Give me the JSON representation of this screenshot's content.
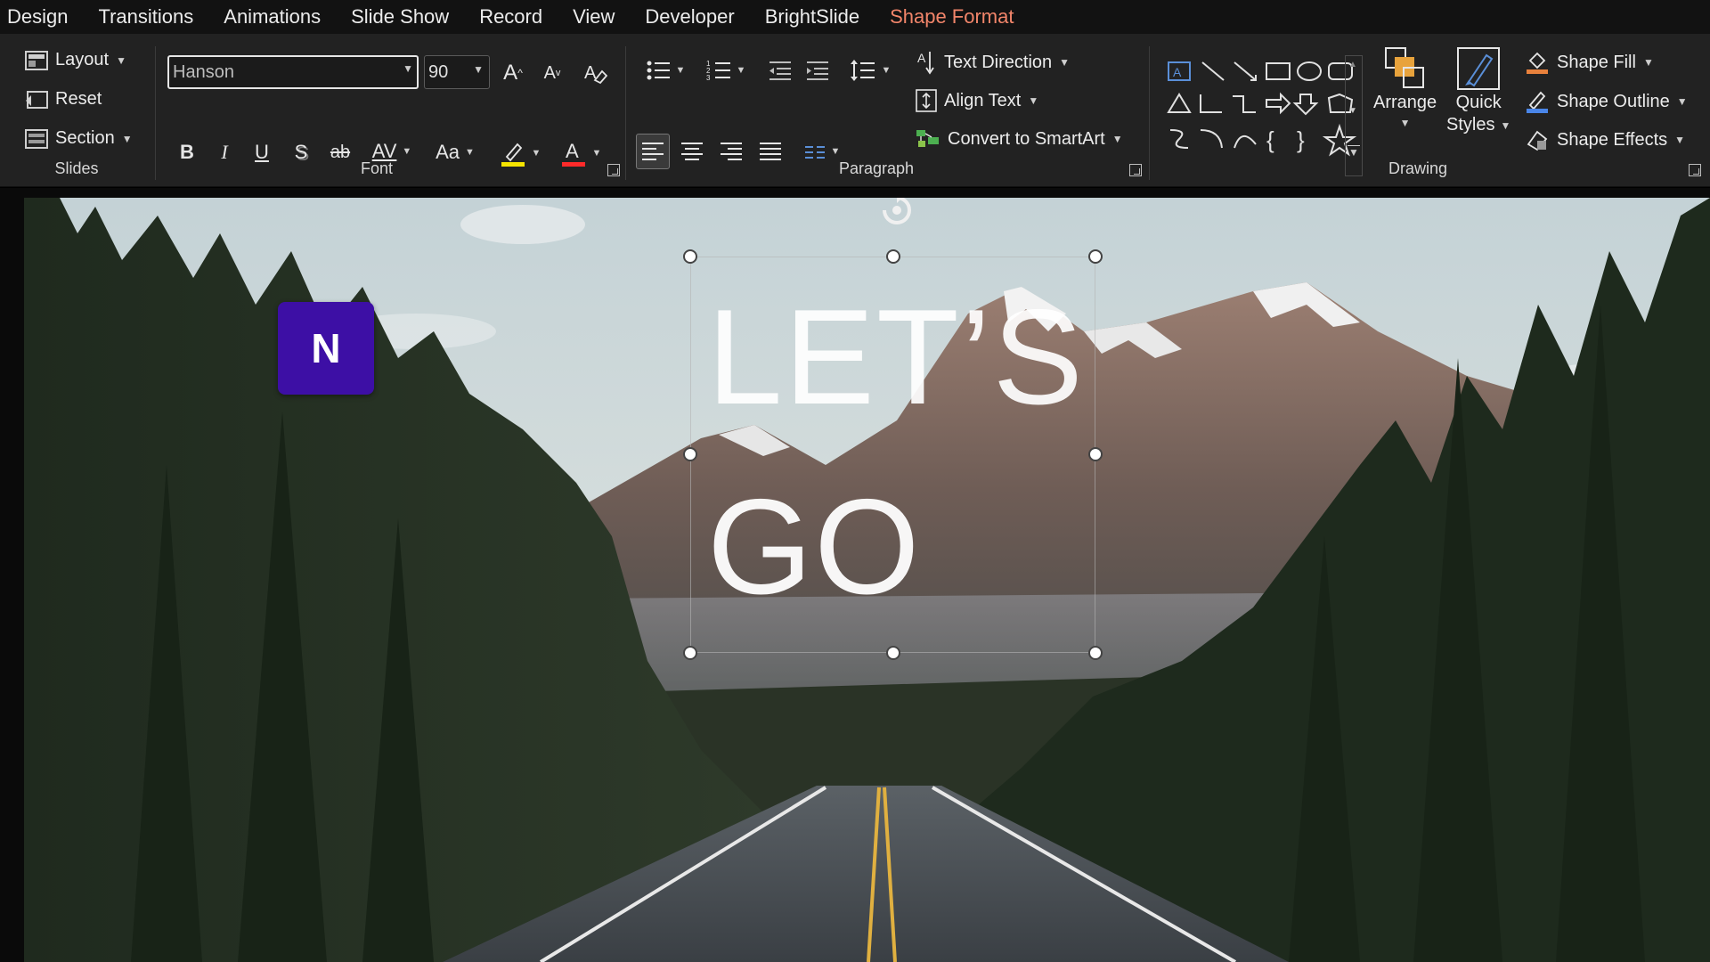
{
  "menubar": {
    "items": [
      "Design",
      "Transitions",
      "Animations",
      "Slide Show",
      "Record",
      "View",
      "Developer",
      "BrightSlide",
      "Shape Format"
    ],
    "active_index": 8
  },
  "slides_group": {
    "layout": "Layout",
    "reset": "Reset",
    "section": "Section",
    "label": "Slides"
  },
  "font_group": {
    "font_name": "Hanson",
    "font_size": "90",
    "label": "Font",
    "bold": "B",
    "italic": "I",
    "underline": "U",
    "shadow": "S",
    "strike": "ab",
    "spacing": "AV",
    "case": "Aa",
    "grow": "A",
    "shrink": "A",
    "font_color_glyph": "A",
    "highlight_color": "#f5e400",
    "font_color": "#ff2a2a"
  },
  "paragraph_group": {
    "text_direction": "Text Direction",
    "align_text": "Align Text",
    "convert_smartart": "Convert to SmartArt",
    "label": "Paragraph"
  },
  "drawing_group": {
    "arrange": "Arrange",
    "quick_styles_1": "Quick",
    "quick_styles_2": "Styles",
    "shape_fill": "Shape Fill",
    "shape_outline": "Shape Outline",
    "shape_effects": "Shape Effects",
    "label": "Drawing"
  },
  "slide": {
    "logo_letter": "N",
    "logo_color": "#3d0fa5",
    "title_line1": "LET’S",
    "title_line2": "GO"
  },
  "colors": {
    "accent_tab": "#f2856a",
    "ribbon_bg": "#222222",
    "menubar_bg": "#121212"
  }
}
